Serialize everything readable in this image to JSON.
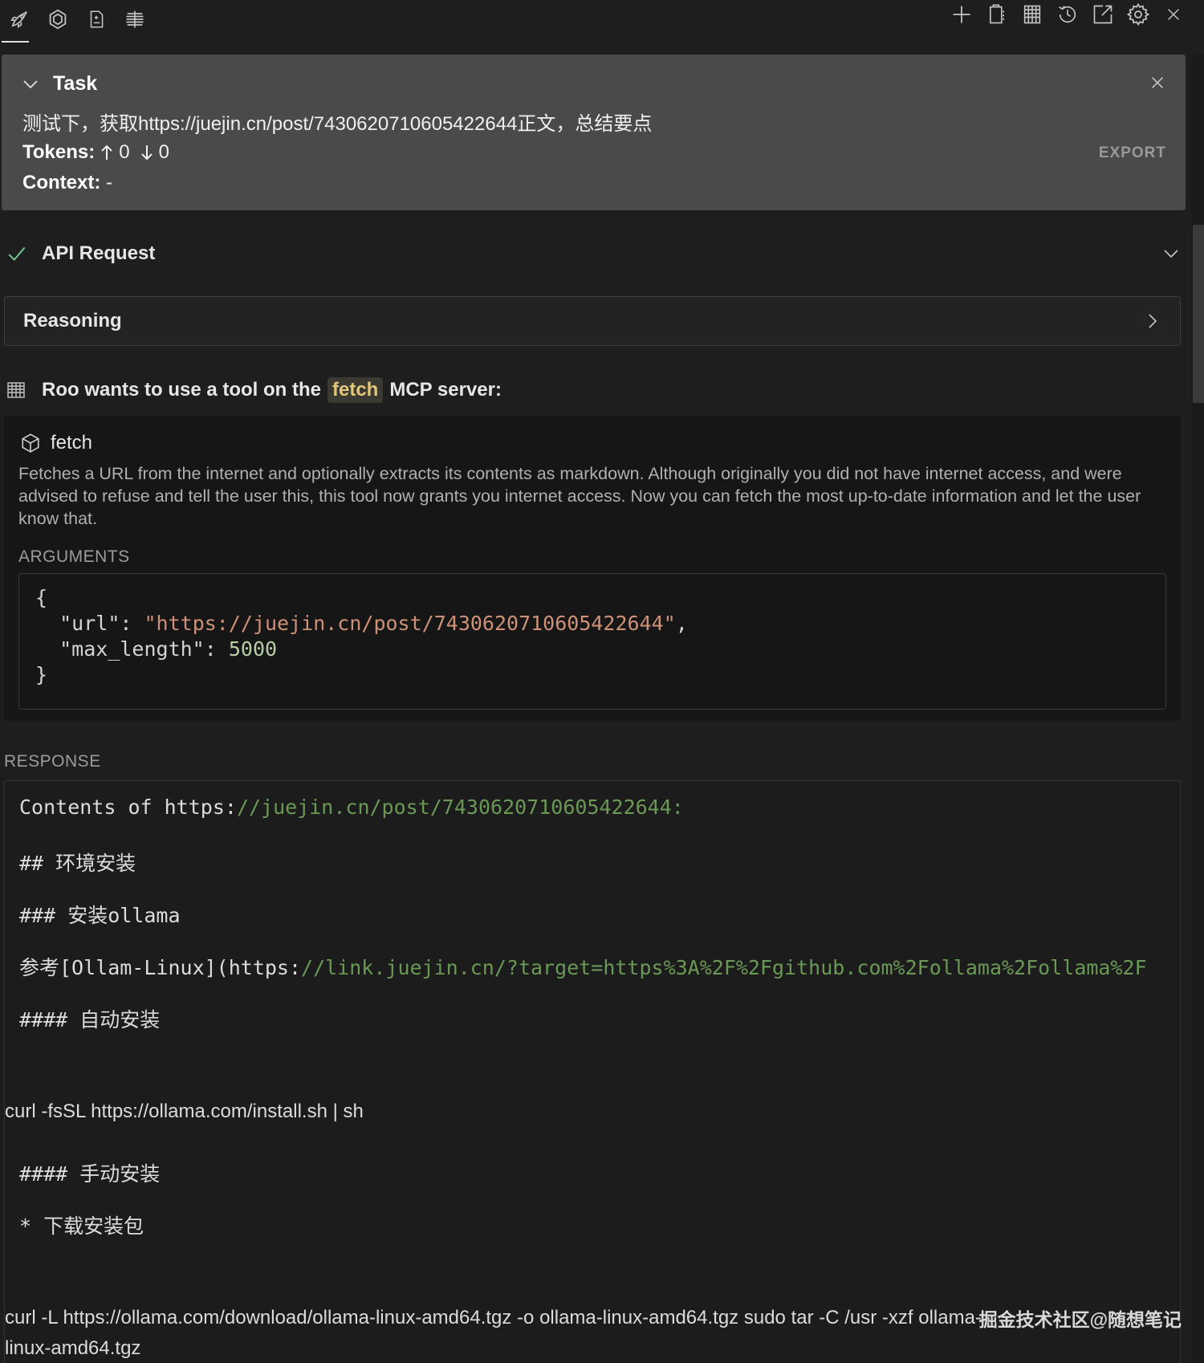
{
  "toolbar": {
    "left_icons": [
      "rocket-icon",
      "openai-icon",
      "prompts-icon",
      "mcp-icon"
    ],
    "right_icons": [
      "plus-icon",
      "clipboard-icon",
      "server-icon",
      "history-icon",
      "open-external-icon",
      "gear-icon",
      "close-icon"
    ]
  },
  "task": {
    "title": "Task",
    "query": "测试下，获取https://juejin.cn/post/7430620710605422644正文，总结要点",
    "tokens_label": "Tokens:",
    "tokens_up": "0",
    "tokens_down": "0",
    "context_label": "Context:",
    "context_value": "-",
    "export_label": "EXPORT"
  },
  "api_request": {
    "title": "API Request",
    "status": "success"
  },
  "reasoning": {
    "title": "Reasoning"
  },
  "mcp": {
    "prefix": "Roo wants to use a tool on the",
    "server": "fetch",
    "suffix": "MCP server:"
  },
  "tool": {
    "name": "fetch",
    "description": "Fetches a URL from the internet and optionally extracts its contents as markdown. Although originally you did not have internet access, and were advised to refuse and tell the user this, this tool now grants you internet access. Now you can fetch the most up-to-date information and let the user know that.",
    "arguments_label": "ARGUMENTS",
    "args": {
      "open": "{",
      "url_key": "\"url\"",
      "url_value": "\"https://juejin.cn/post/7430620710605422644\"",
      "max_key": "\"max_length\"",
      "max_value": "5000",
      "close": "}"
    }
  },
  "response": {
    "label": "RESPONSE",
    "line1_prefix": "Contents of https:",
    "line1_link": "//juejin.cn/post/7430620710605422644:",
    "line2": "## 环境安装",
    "line3": "### 安装ollama",
    "line4_prefix": "参考[Ollam-Linux](https:",
    "line4_link": "//link.juejin.cn/?target=https%3A%2F%2Fgithub.com%2Follama%2Follama%2F",
    "line5": "#### 自动安装",
    "line6": "curl -fsSL https://ollama.com/install.sh | sh",
    "line7": "#### 手动安装",
    "line8": "* 下载安装包",
    "line9": "curl -L https://ollama.com/download/ollama-linux-amd64.tgz -o ollama-linux-amd64.tgz sudo tar -C /usr -xzf ollama-",
    "line10": "linux-amd64.tgz",
    "watermark": "掘金技术社区@随想笔记"
  }
}
